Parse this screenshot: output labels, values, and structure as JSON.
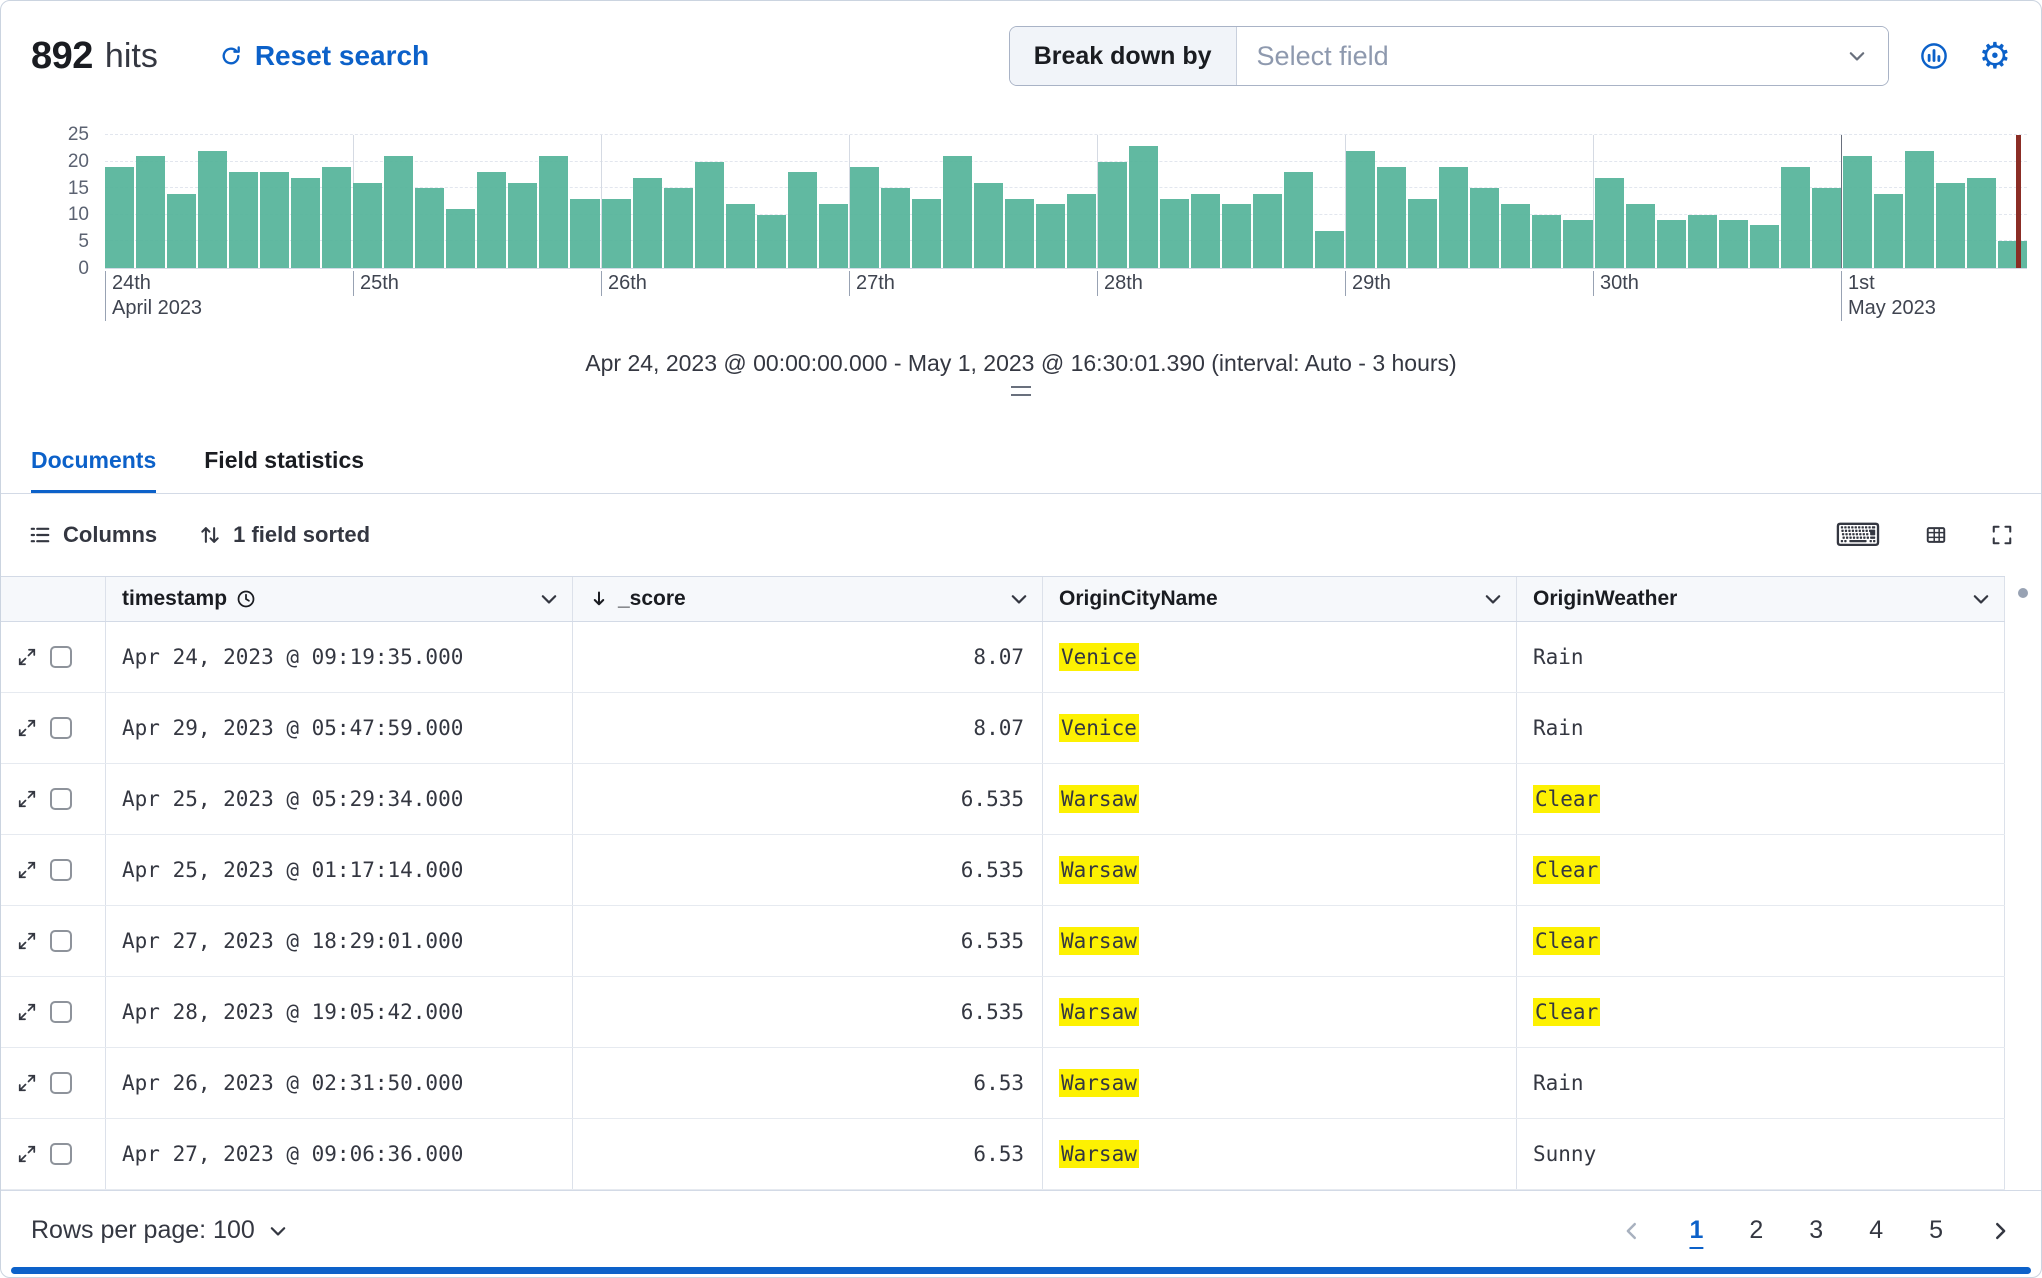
{
  "header": {
    "hits_count": "892",
    "hits_label": "hits",
    "reset_search": "Reset search",
    "breakdown_label": "Break down by",
    "breakdown_placeholder": "Select field"
  },
  "icons": {
    "gear": "⚙",
    "keyboard": "⌨"
  },
  "chart_data": {
    "type": "bar",
    "title": "Apr 24, 2023 @ 00:00:00.000 - May 1, 2023 @ 16:30:01.390 (interval: Auto - 3 hours)",
    "xlabel": "",
    "ylabel": "",
    "ylim": [
      0,
      25
    ],
    "y_ticks": [
      25,
      20,
      15,
      10,
      5,
      0
    ],
    "grid": true,
    "legend": "none",
    "interval": "3 hours",
    "bar_color": "#54B399",
    "end_marker_color": "#8B2D25",
    "values": [
      19,
      21,
      14,
      22,
      18,
      18,
      17,
      19,
      16,
      21,
      15,
      11,
      18,
      16,
      21,
      13,
      13,
      17,
      15,
      20,
      12,
      10,
      18,
      12,
      19,
      15,
      13,
      21,
      16,
      13,
      12,
      14,
      20,
      23,
      13,
      14,
      12,
      14,
      18,
      7,
      22,
      19,
      13,
      19,
      15,
      12,
      10,
      9,
      17,
      12,
      9,
      10,
      9,
      8,
      19,
      15,
      21,
      14,
      22,
      16,
      17,
      5
    ],
    "x_day_labels": [
      {
        "label": "24th",
        "sub": "April 2023",
        "index": 0,
        "dark": false
      },
      {
        "label": "25th",
        "sub": "",
        "index": 8,
        "dark": false
      },
      {
        "label": "26th",
        "sub": "",
        "index": 16,
        "dark": false
      },
      {
        "label": "27th",
        "sub": "",
        "index": 24,
        "dark": false
      },
      {
        "label": "28th",
        "sub": "",
        "index": 32,
        "dark": false
      },
      {
        "label": "29th",
        "sub": "",
        "index": 40,
        "dark": false
      },
      {
        "label": "30th",
        "sub": "",
        "index": 48,
        "dark": false
      },
      {
        "label": "1st",
        "sub": "May 2023",
        "index": 56,
        "dark": true
      }
    ]
  },
  "tabs": [
    {
      "label": "Documents",
      "active": true
    },
    {
      "label": "Field statistics",
      "active": false
    }
  ],
  "toolbar": {
    "columns_label": "Columns",
    "sorted_label": "1 field sorted"
  },
  "table": {
    "columns": [
      {
        "label": "timestamp",
        "icon": "clock-icon"
      },
      {
        "label": "_score",
        "icon": "sort-desc-icon"
      },
      {
        "label": "OriginCityName"
      },
      {
        "label": "OriginWeather"
      }
    ],
    "rows": [
      {
        "timestamp": "Apr 24, 2023 @ 09:19:35.000",
        "score": "8.07",
        "city": "Venice",
        "city_highlighted": true,
        "weather": "Rain",
        "weather_highlighted": false
      },
      {
        "timestamp": "Apr 29, 2023 @ 05:47:59.000",
        "score": "8.07",
        "city": "Venice",
        "city_highlighted": true,
        "weather": "Rain",
        "weather_highlighted": false
      },
      {
        "timestamp": "Apr 25, 2023 @ 05:29:34.000",
        "score": "6.535",
        "city": "Warsaw",
        "city_highlighted": true,
        "weather": "Clear",
        "weather_highlighted": true
      },
      {
        "timestamp": "Apr 25, 2023 @ 01:17:14.000",
        "score": "6.535",
        "city": "Warsaw",
        "city_highlighted": true,
        "weather": "Clear",
        "weather_highlighted": true
      },
      {
        "timestamp": "Apr 27, 2023 @ 18:29:01.000",
        "score": "6.535",
        "city": "Warsaw",
        "city_highlighted": true,
        "weather": "Clear",
        "weather_highlighted": true
      },
      {
        "timestamp": "Apr 28, 2023 @ 19:05:42.000",
        "score": "6.535",
        "city": "Warsaw",
        "city_highlighted": true,
        "weather": "Clear",
        "weather_highlighted": true
      },
      {
        "timestamp": "Apr 26, 2023 @ 02:31:50.000",
        "score": "6.53",
        "city": "Warsaw",
        "city_highlighted": true,
        "weather": "Rain",
        "weather_highlighted": false
      },
      {
        "timestamp": "Apr 27, 2023 @ 09:06:36.000",
        "score": "6.53",
        "city": "Warsaw",
        "city_highlighted": true,
        "weather": "Sunny",
        "weather_highlighted": false
      }
    ]
  },
  "footer": {
    "rows_per_page_label": "Rows per page: 100",
    "pages": [
      "1",
      "2",
      "3",
      "4",
      "5"
    ],
    "active_page": "1"
  },
  "colors": {
    "primary": "#0C61C9",
    "highlight": "#FDF102",
    "bar": "#54B399"
  }
}
